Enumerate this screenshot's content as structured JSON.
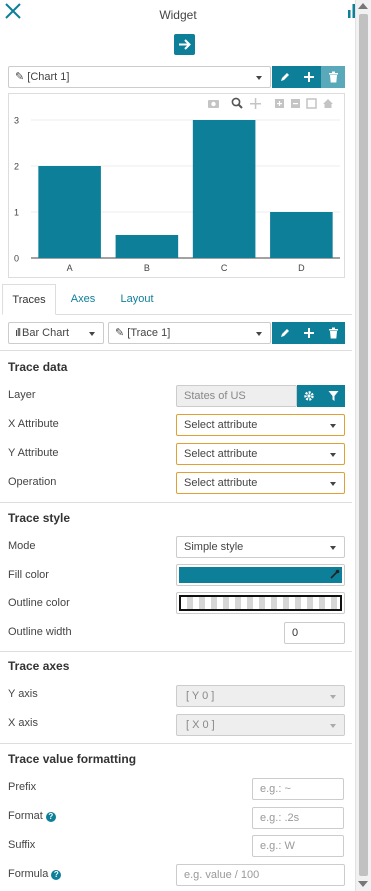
{
  "header": {
    "title": "Widget"
  },
  "chart_selector": {
    "value": "[Chart 1]"
  },
  "chart_data": {
    "type": "bar",
    "categories": [
      "A",
      "B",
      "C",
      "D"
    ],
    "values": [
      2,
      0.5,
      3,
      1
    ],
    "yticks": [
      "0",
      "1",
      "2",
      "3"
    ],
    "ylim": [
      0,
      3
    ],
    "color": "#0e7f99",
    "grid": true
  },
  "tabs": [
    {
      "label": "Traces",
      "active": true
    },
    {
      "label": "Axes",
      "active": false
    },
    {
      "label": "Layout",
      "active": false
    }
  ],
  "trace_bar": {
    "type_label": "Bar Chart",
    "trace_label": "[Trace 1]"
  },
  "trace_data": {
    "title": "Trace data",
    "layer_label": "Layer",
    "layer_value": "States of US",
    "x_label": "X Attribute",
    "x_value": "Select attribute",
    "y_label": "Y Attribute",
    "y_value": "Select attribute",
    "operation_label": "Operation",
    "operation_value": "Select attribute"
  },
  "trace_style": {
    "title": "Trace style",
    "mode_label": "Mode",
    "mode_value": "Simple style",
    "fill_label": "Fill color",
    "fill_color": "#0e7f99",
    "outline_label": "Outline color",
    "outline_width_label": "Outline width",
    "outline_width_value": "0"
  },
  "trace_axes": {
    "title": "Trace axes",
    "y_label": "Y axis",
    "y_value": "[ Y 0 ]",
    "x_label": "X axis",
    "x_value": "[ X 0 ]"
  },
  "formatting": {
    "title": "Trace value formatting",
    "prefix_label": "Prefix",
    "prefix_placeholder": "e.g.: ~",
    "format_label": "Format",
    "format_placeholder": "e.g.: .2s",
    "suffix_label": "Suffix",
    "suffix_placeholder": "e.g.: W",
    "formula_label": "Formula",
    "formula_placeholder": "e.g. value / 100"
  },
  "colors": {
    "accent": "#0e7f99",
    "warning": "#e0a132"
  }
}
